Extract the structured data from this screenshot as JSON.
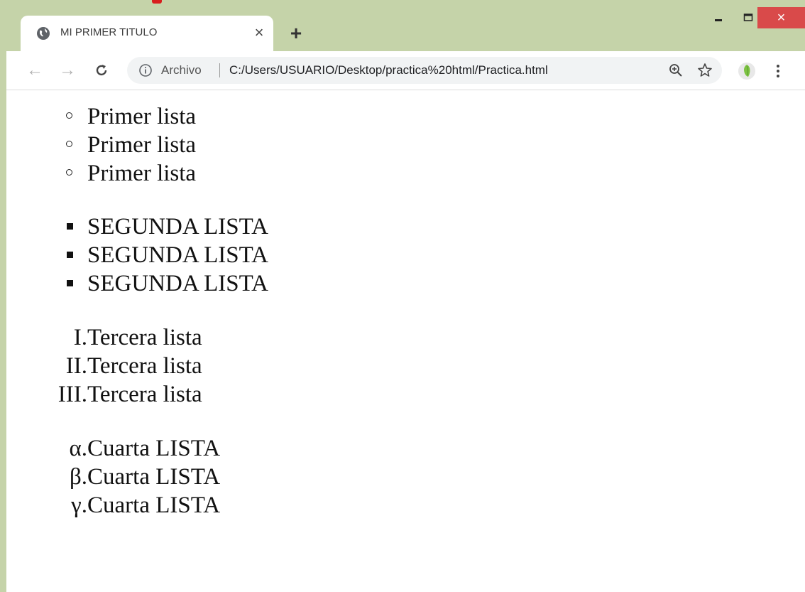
{
  "tab": {
    "title": "MI PRIMER TITULO",
    "close_glyph": "×",
    "new_tab_glyph": "+"
  },
  "window_controls": {
    "close_glyph": "×"
  },
  "toolbar": {
    "back_glyph": "←",
    "forward_glyph": "→",
    "reload_glyph": "C",
    "scheme_label": "Archivo",
    "url": "C:/Users/USUARIO/Desktop/practica%20html/Practica.html"
  },
  "page": {
    "list1": {
      "marker": "circle",
      "items": [
        "Primer lista",
        "Primer lista",
        "Primer lista"
      ]
    },
    "list2": {
      "marker": "square",
      "items": [
        "SEGUNDA LISTA",
        "SEGUNDA LISTA",
        "SEGUNDA LISTA"
      ]
    },
    "list3": {
      "marker": "upper-roman",
      "ordinals": [
        "I.",
        "II.",
        "III."
      ],
      "items": [
        "Tercera lista",
        "Tercera lista",
        "Tercera lista"
      ]
    },
    "list4": {
      "marker": "lower-greek",
      "ordinals": [
        "α.",
        "β.",
        "γ."
      ],
      "items": [
        "Cuarta LISTA",
        "Cuarta LISTA",
        "Cuarta LISTA"
      ]
    }
  },
  "colors": {
    "frame": "#c5d3a9",
    "close_button": "#d94a4a",
    "omnibox": "#f1f3f4",
    "accent_red": "#d81e1e"
  },
  "icons": {
    "favicon": "globe-icon",
    "info": "info-icon",
    "zoom": "zoom-icon",
    "bookmark": "star-icon",
    "extension": "extension-icon",
    "menu": "kebab-menu-icon"
  }
}
